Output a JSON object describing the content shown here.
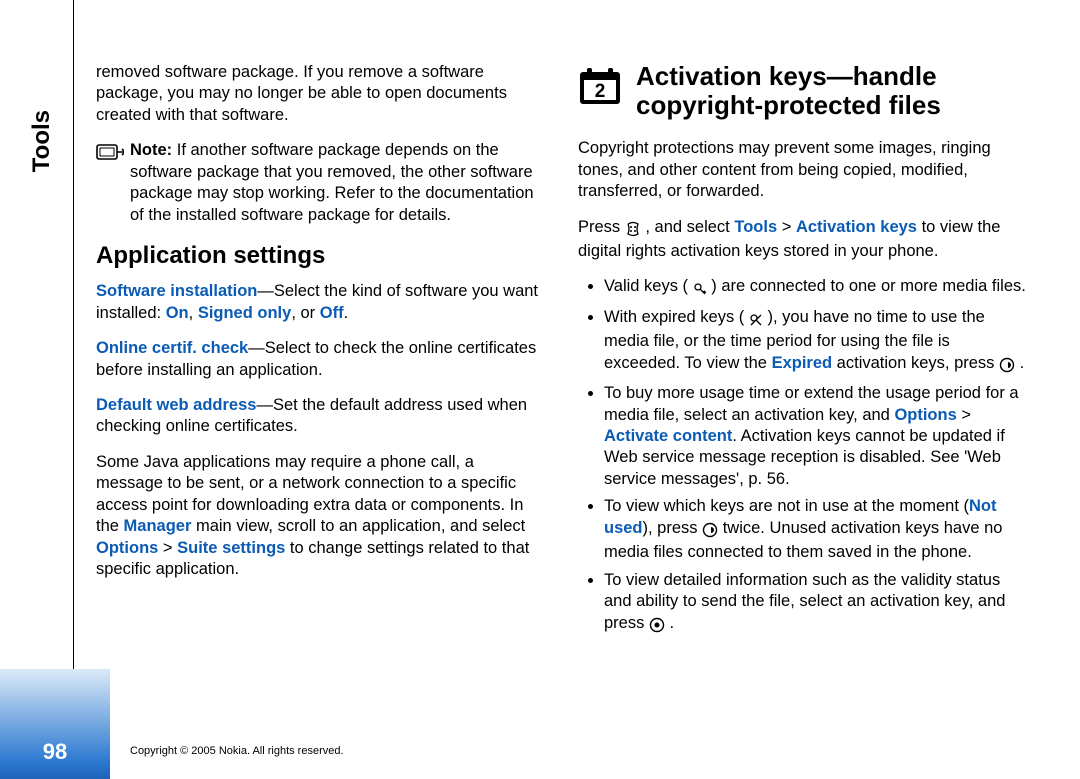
{
  "side_tab": "Tools",
  "page_number": "98",
  "copyright": "Copyright © 2005 Nokia. All rights reserved.",
  "left": {
    "intro": "removed software package. If you remove a software package, you may no longer be able to open documents created with that software.",
    "note_label": "Note:",
    "note_body": " If another software package depends on the software package that you removed, the other software package may stop working. Refer to the documentation of the installed software package for details.",
    "h2": "Application settings",
    "p1a": "Software installation",
    "p1b": "—Select the kind of software you want installed: ",
    "p1c": "On",
    "p1d": ", ",
    "p1e": "Signed only",
    "p1f": ", or ",
    "p1g": "Off",
    "p1h": ".",
    "p2a": "Online certif. check",
    "p2b": "—Select to check the online certificates before installing an application.",
    "p3a": "Default web address",
    "p3b": "—Set the default address used when checking online certificates.",
    "p4a": "Some Java applications may require a phone call, a message to be sent, or a network connection to a specific access point for downloading extra data or components. In the ",
    "p4b": "Manager",
    "p4c": " main view, scroll to an application, and select ",
    "p4d": "Options",
    "p4e": " > ",
    "p4f": "Suite settings",
    "p4g": " to change settings related to that specific application."
  },
  "right": {
    "h1_line1": "Activation keys—handle",
    "h1_line2": "copyright-protected files",
    "p1": "Copyright protections may prevent some images, ringing tones, and other content from being copied, modified, transferred, or forwarded.",
    "p2a": "Press ",
    "p2b": " , and select ",
    "p2c": "Tools",
    "p2d": " > ",
    "p2e": "Activation keys",
    "p2f": " to view the digital rights activation keys stored in your phone.",
    "b1a": "Valid keys (",
    "b1b": ") are connected to one or more media files.",
    "b2a": "With expired keys (",
    "b2b": "), you have no time to use the media file, or the time period for using the file is exceeded. To view the ",
    "b2c": "Expired",
    "b2d": " activation keys, press ",
    "b2e": ".",
    "b3a": "To buy more usage time or extend the usage period for a media file, select an activation key, and ",
    "b3b": "Options",
    "b3c": " > ",
    "b3d": "Activate content",
    "b3e": ". Activation keys cannot be updated if Web service message reception is disabled. See 'Web service messages', p. 56.",
    "b4a": "To view which keys are not in use at the moment (",
    "b4b": "Not used",
    "b4c": "), press ",
    "b4d": " twice. Unused activation keys have no media files connected to them saved in the phone.",
    "b5a": "To view detailed information such as the validity status and ability to send the file, select an activation key, and press ",
    "b5b": "."
  }
}
